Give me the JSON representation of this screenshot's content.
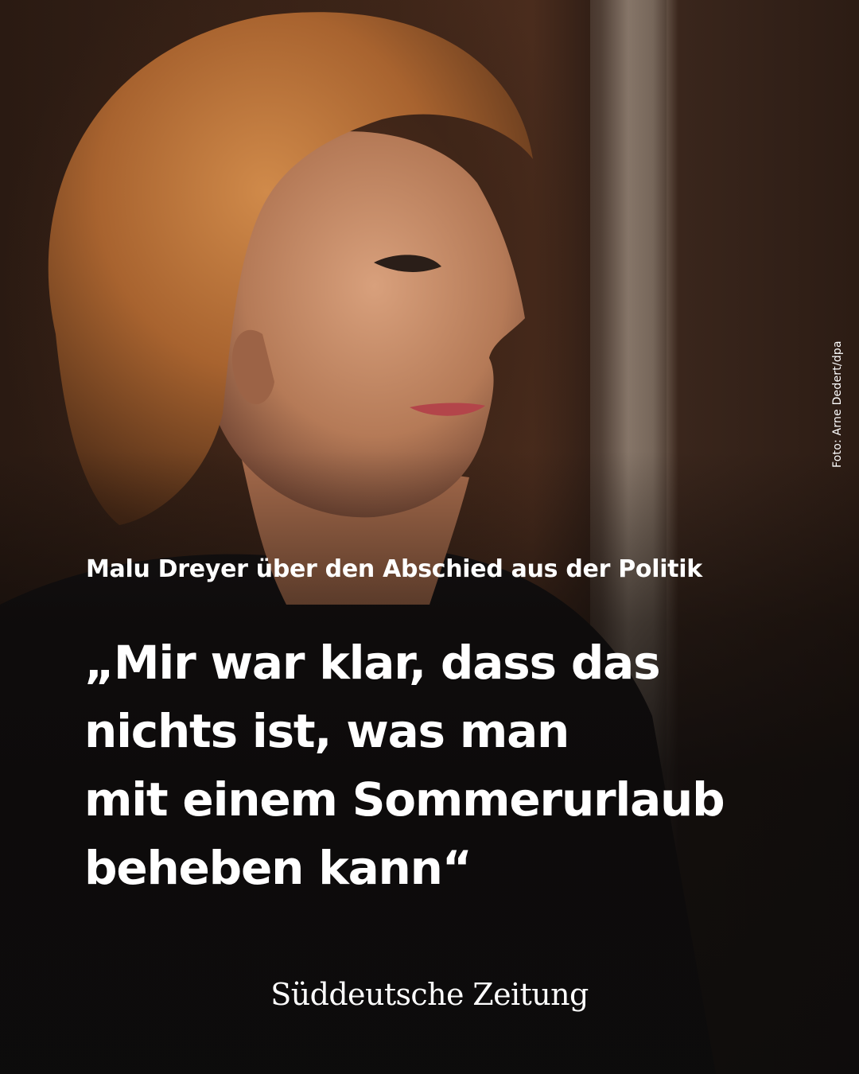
{
  "photo": {
    "description_icon": "portrait-photo",
    "credit": "Foto: Arne Dedert/dpa"
  },
  "headline": {
    "kicker": "Malu Dreyer über den Abschied aus der Politik",
    "quote_lines": [
      "„Mir war klar, dass das",
      "nichts ist, was man",
      "mit einem Sommerurlaub",
      "beheben kann“"
    ]
  },
  "brand": {
    "logo_text": "Süddeutsche Zeitung"
  },
  "colors": {
    "text": "#ffffff",
    "hair": "#b8733a",
    "background": "#2a1a12"
  }
}
